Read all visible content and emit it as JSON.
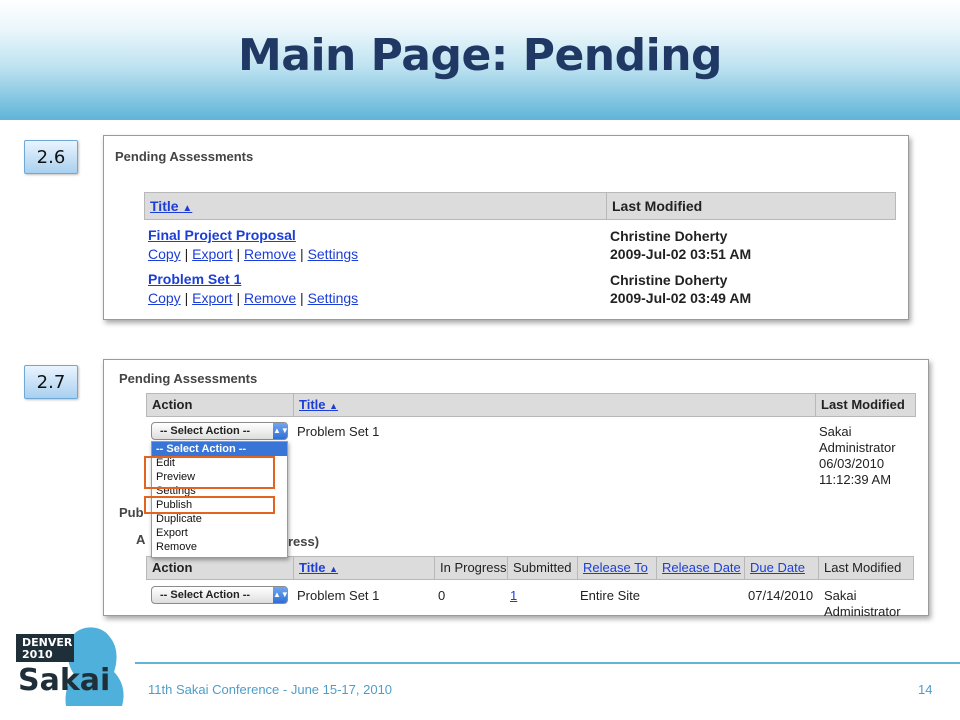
{
  "slide": {
    "title": "Main Page: Pending",
    "footer": "11th Sakai Conference - June 15-17, 2010",
    "page_number": "14"
  },
  "logo": {
    "line1": "DENVER",
    "line2": "2010",
    "brand": "Sakai"
  },
  "section_a": {
    "tag": "2.6",
    "heading": "Pending Assessments",
    "columns": {
      "title": "Title",
      "last_modified": "Last Modified"
    },
    "rows": [
      {
        "title": "Final Project Proposal",
        "author": "Christine Doherty",
        "date": "2009-Jul-02 03:51 AM"
      },
      {
        "title": "Problem Set 1",
        "author": "Christine Doherty",
        "date": "2009-Jul-02 03:49 AM"
      }
    ],
    "actions": {
      "copy": "Copy",
      "export": "Export",
      "remove": "Remove",
      "settings": "Settings",
      "sep": "|"
    }
  },
  "section_b": {
    "tag": "2.7",
    "heading": "Pending Assessments",
    "columns": {
      "action": "Action",
      "title": "Title",
      "last_modified": "Last Modified"
    },
    "row": {
      "title": "Problem Set 1",
      "modified_lines": [
        "Sakai",
        "Administrator",
        "06/03/2010",
        "11:12:39 AM"
      ]
    },
    "select_placeholder": "-- Select Action --",
    "dropdown": [
      "-- Select Action --",
      "Edit",
      "Preview",
      "Settings",
      "Publish",
      "Duplicate",
      "Export",
      "Remove"
    ],
    "partial_heading_1": "Pub",
    "partial_heading_2": "A",
    "partial_heading_3": "ress)",
    "published_columns": {
      "action": "Action",
      "title": "Title",
      "in_progress": "In Progress",
      "submitted": "Submitted",
      "release_to": "Release To",
      "release_date": "Release Date",
      "due_date": "Due Date",
      "last_modified": "Last Modified"
    },
    "published_row": {
      "title": "Problem Set 1",
      "in_progress": "0",
      "submitted": "1",
      "release_to": "Entire Site",
      "due_date": "07/14/2010",
      "modified_1": "Sakai",
      "modified_2": "Administrator"
    }
  },
  "colors": {
    "title": "#1f3864",
    "link": "#1c3ed6",
    "highlight": "#e2641f",
    "accent": "#5fb4d8"
  }
}
